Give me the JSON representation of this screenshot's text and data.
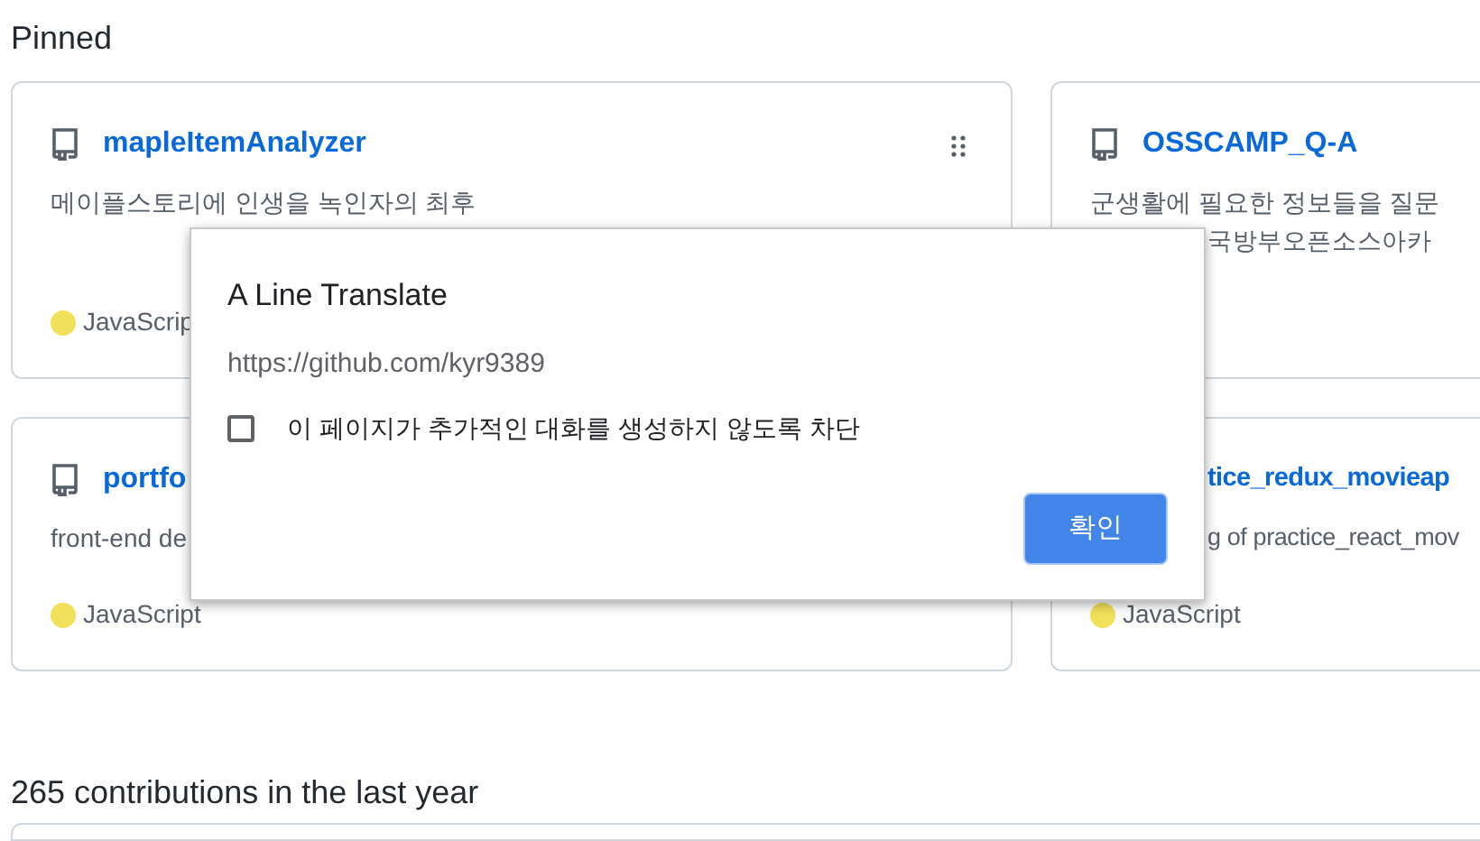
{
  "section_title": "Pinned",
  "cards": [
    {
      "kind": "plain",
      "title": "mapleItemAnalyzer",
      "grip": true,
      "description": [
        {
          "kind": "plain",
          "text": "메이플스토리에 인생을 녹인자의 최후"
        }
      ],
      "language": {
        "name": "JavaScrip",
        "color": "#f1e05a"
      }
    },
    {
      "kind": "plain",
      "title": "OSSCAMP_Q-A",
      "grip": false,
      "description": [
        {
          "kind": "plain",
          "text": "군생활에 필요한 정보들을 질문"
        },
        {
          "kind": "covered",
          "text": "국방부오픈소스아카"
        }
      ]
    },
    {
      "kind": "plain",
      "title": "portfo",
      "grip": false,
      "description": [
        {
          "kind": "plain",
          "text": "front-end de"
        }
      ],
      "language": {
        "name": "JavaScript",
        "color": "#f1e05a"
      }
    },
    {
      "kind": "covered",
      "title": "tice_redux_movieap",
      "grip": false,
      "description": [
        {
          "kind": "covered",
          "text": "g of practice_react_mov"
        }
      ],
      "language": {
        "name": "JavaScript",
        "color": "#f1e05a"
      }
    }
  ],
  "contributions": "265 contributions in the last year",
  "dialog": {
    "title": "A Line Translate",
    "url": "https://github.com/kyr9389",
    "checkbox": {
      "label": "이 페이지가 추가적인 대화를 생성하지 않도록 차단",
      "checked": false
    },
    "button": "확인"
  }
}
